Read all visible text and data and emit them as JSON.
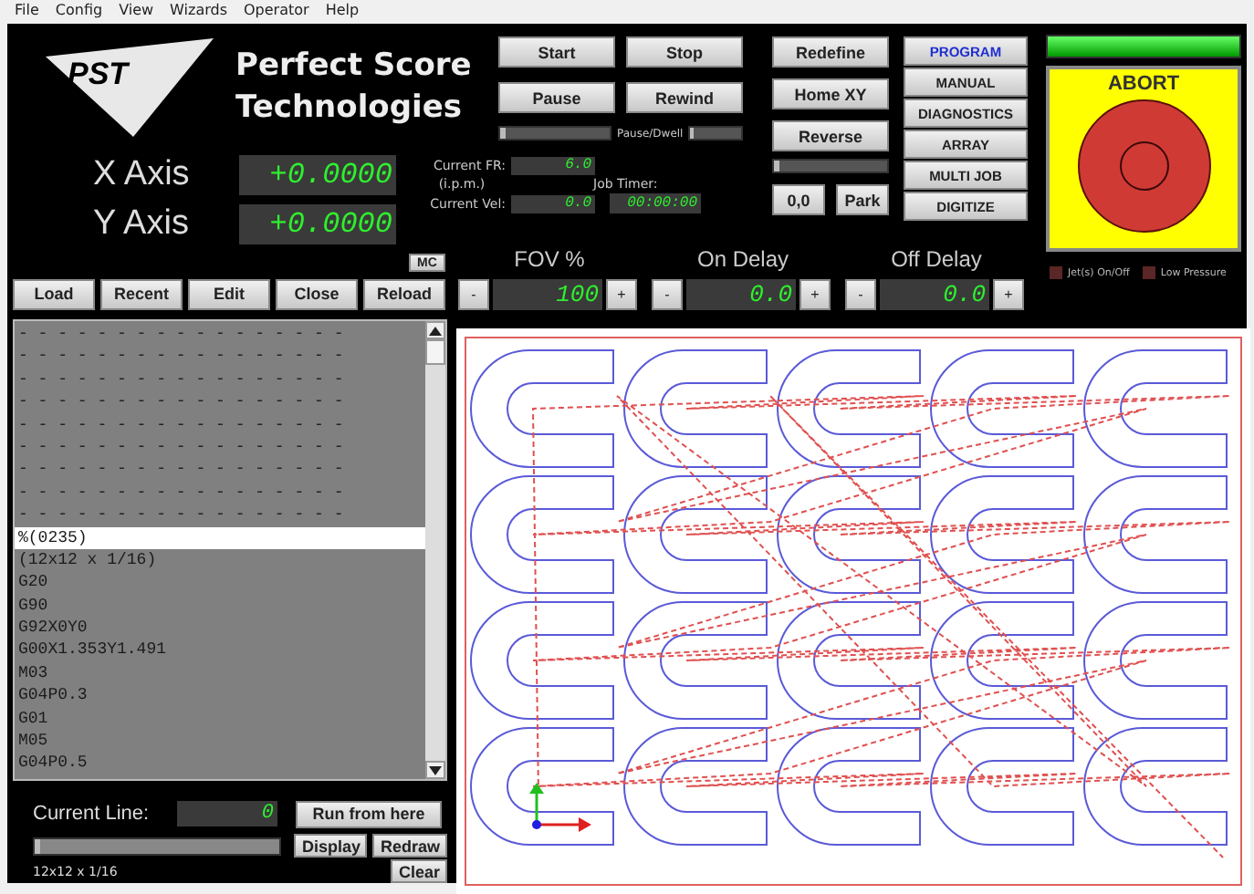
{
  "menu": [
    {
      "label": "File"
    },
    {
      "label": "Config"
    },
    {
      "label": "View"
    },
    {
      "label": "Wizards"
    },
    {
      "label": "Operator"
    },
    {
      "label": "Help"
    }
  ],
  "logo": {
    "text": "PST",
    "company": [
      "Perfect Score",
      "Technologies"
    ]
  },
  "axes": [
    {
      "label": "X Axis",
      "value": "+0.0000"
    },
    {
      "label": "Y Axis",
      "value": "+0.0000"
    }
  ],
  "run_buttons": [
    {
      "label": "Start"
    },
    {
      "label": "Stop"
    },
    {
      "label": "Pause"
    },
    {
      "label": "Rewind"
    }
  ],
  "pause_dwell": {
    "label": "Pause/Dwell",
    "bars": [
      {
        "level": 0.05
      },
      {
        "level": 0.05
      }
    ]
  },
  "feed": {
    "fr_label": "Current FR:",
    "units": "(i.p.m.)",
    "fr_value": "6.0",
    "vel_label": "Current Vel:",
    "vel_value": "0.0",
    "timer_label": "Job Timer:",
    "timer_value": "00:00:00"
  },
  "position_buttons": [
    {
      "label": "Redefine"
    },
    {
      "label": "Home XY"
    },
    {
      "label": "Reverse"
    }
  ],
  "reverse_bar": {
    "level": 0.05
  },
  "park_buttons": [
    {
      "label": "0,0"
    },
    {
      "label": "Park"
    }
  ],
  "modes": [
    {
      "label": "PROGRAM",
      "selected": true
    },
    {
      "label": "MANUAL",
      "selected": false
    },
    {
      "label": "DIAGNOSTICS",
      "selected": false
    },
    {
      "label": "ARRAY",
      "selected": false
    },
    {
      "label": "MULTI JOB",
      "selected": false
    },
    {
      "label": "DIGITIZE",
      "selected": false
    }
  ],
  "abort": {
    "label": "ABORT"
  },
  "lights": [
    {
      "label": "Jet(s) On/Off",
      "on": false
    },
    {
      "label": "Low Pressure",
      "on": false
    }
  ],
  "mc_button": {
    "label": "MC"
  },
  "file_buttons": [
    {
      "label": "Load"
    },
    {
      "label": "Recent"
    },
    {
      "label": "Edit"
    },
    {
      "label": "Close"
    },
    {
      "label": "Reload"
    }
  ],
  "spinners": [
    {
      "label": "FOV %",
      "minus": "-",
      "value": "100",
      "plus": "+"
    },
    {
      "label": "On Delay",
      "minus": "-",
      "value": "0.0",
      "plus": "+"
    },
    {
      "label": "Off Delay",
      "minus": "-",
      "value": "0.0",
      "plus": "+"
    }
  ],
  "code_lines": [
    {
      "text": "- - - - - - - - - - - - - - - - -",
      "selected": false
    },
    {
      "text": "- - - - - - - - - - - - - - - - -",
      "selected": false
    },
    {
      "text": "- - - - - - - - - - - - - - - - -",
      "selected": false
    },
    {
      "text": "- - - - - - - - - - - - - - - - -",
      "selected": false
    },
    {
      "text": "- - - - - - - - - - - - - - - - -",
      "selected": false
    },
    {
      "text": "- - - - - - - - - - - - - - - - -",
      "selected": false
    },
    {
      "text": "- - - - - - - - - - - - - - - - -",
      "selected": false
    },
    {
      "text": "- - - - - - - - - - - - - - - - -",
      "selected": false
    },
    {
      "text": "- - - - - - - - - - - - - - - - -",
      "selected": false
    },
    {
      "text": "%(0235)",
      "selected": true
    },
    {
      "text": "(12x12 x 1/16)",
      "selected": false
    },
    {
      "text": "G20",
      "selected": false
    },
    {
      "text": "G90",
      "selected": false
    },
    {
      "text": "G92X0Y0",
      "selected": false
    },
    {
      "text": "G00X1.353Y1.491",
      "selected": false
    },
    {
      "text": "M03",
      "selected": false
    },
    {
      "text": "G04P0.3",
      "selected": false
    },
    {
      "text": "G01",
      "selected": false
    },
    {
      "text": "M05",
      "selected": false
    },
    {
      "text": "G04P0.5",
      "selected": false
    }
  ],
  "current_line": {
    "label": "Current Line:",
    "value": "0"
  },
  "file_progress": {
    "level": 0.02
  },
  "plot_buttons": [
    {
      "label": "Run from here"
    },
    {
      "label": "Display"
    },
    {
      "label": "Redraw"
    },
    {
      "label": "Clear"
    }
  ],
  "status": "12x12 x 1/16"
}
